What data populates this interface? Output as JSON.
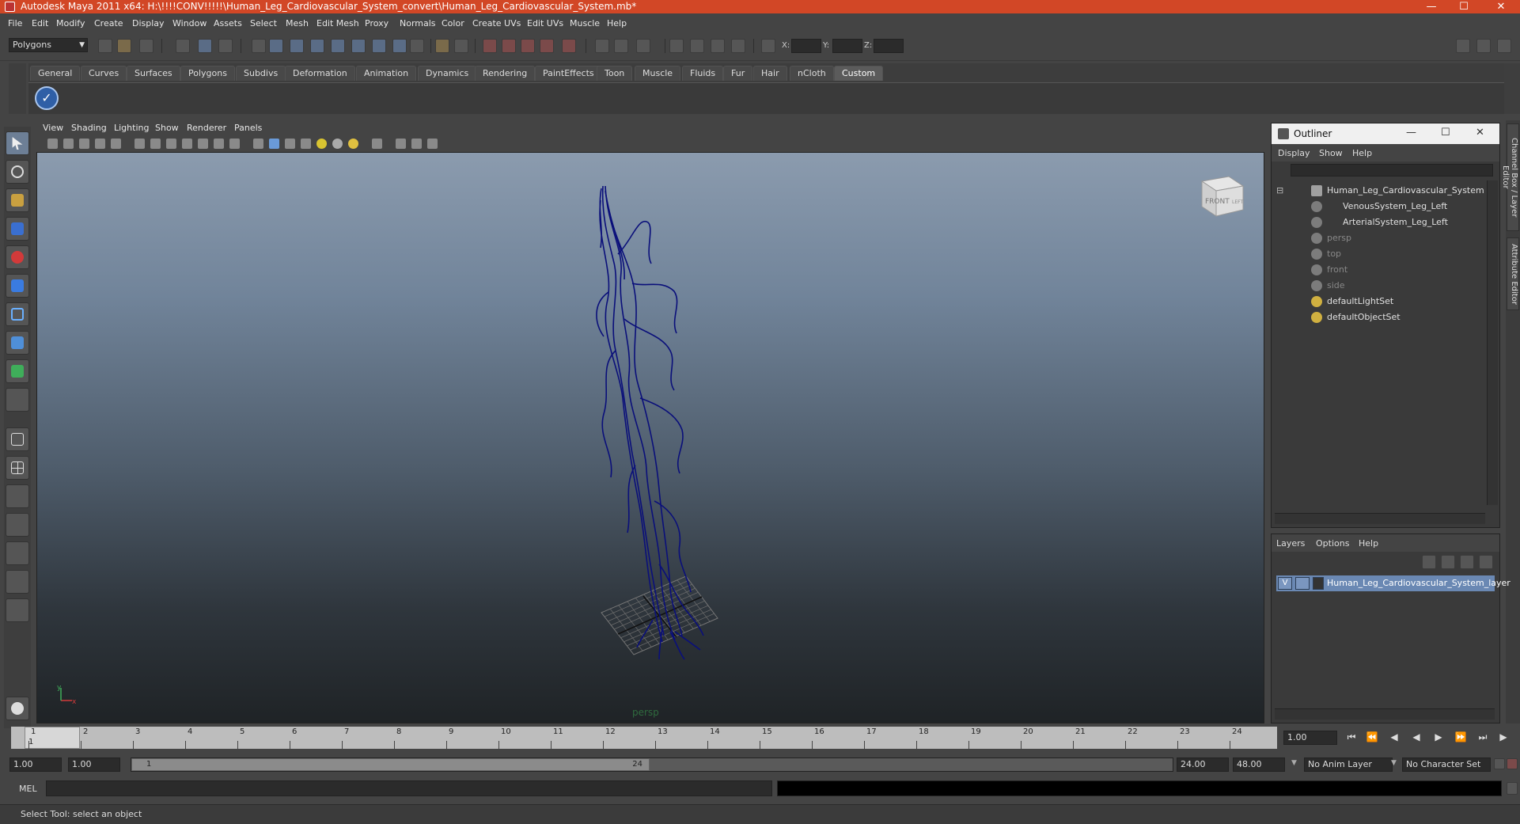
{
  "window": {
    "title": "Autodesk Maya 2011 x64: H:\\!!!!CONV!!!!!\\Human_Leg_Cardiovascular_System_convert\\Human_Leg_Cardiovascular_System.mb*"
  },
  "menu": [
    "File",
    "Edit",
    "Modify",
    "Create",
    "Display",
    "Window",
    "Assets",
    "Select",
    "Mesh",
    "Edit Mesh",
    "Proxy",
    "Normals",
    "Color",
    "Create UVs",
    "Edit UVs",
    "Muscle",
    "Help"
  ],
  "status_line": {
    "mode": "Polygons",
    "x_label": "X:",
    "y_label": "Y:",
    "z_label": "Z:"
  },
  "shelf": {
    "tabs": [
      "General",
      "Curves",
      "Surfaces",
      "Polygons",
      "Subdivs",
      "Deformation",
      "Animation",
      "Dynamics",
      "Rendering",
      "PaintEffects",
      "Toon",
      "Muscle",
      "Fluids",
      "Fur",
      "Hair",
      "nCloth",
      "Custom"
    ],
    "active_tab": "Custom"
  },
  "viewport": {
    "menu": [
      "View",
      "Shading",
      "Lighting",
      "Show",
      "Renderer",
      "Panels"
    ],
    "camera": "persp",
    "viewcube_label": "FRONT",
    "viewcube_side": "LEFT",
    "axis_x": "x",
    "axis_y": "y",
    "wire_color": "#0a0f7a"
  },
  "side_tabs": [
    "Channel Box / Layer Editor",
    "Attribute Editor"
  ],
  "outliner": {
    "title": "Outliner",
    "menu": [
      "Display",
      "Show",
      "Help"
    ],
    "items": [
      {
        "label": "Human_Leg_Cardiovascular_System",
        "dim": false
      },
      {
        "label": "VenousSystem_Leg_Left",
        "dim": false
      },
      {
        "label": "ArterialSystem_Leg_Left",
        "dim": false
      },
      {
        "label": "persp",
        "dim": true
      },
      {
        "label": "top",
        "dim": true
      },
      {
        "label": "front",
        "dim": true
      },
      {
        "label": "side",
        "dim": true
      },
      {
        "label": "defaultLightSet",
        "dim": false
      },
      {
        "label": "defaultObjectSet",
        "dim": false
      }
    ]
  },
  "layers": {
    "menu": [
      "Layers",
      "Options",
      "Help"
    ],
    "rows": [
      {
        "visible": "V",
        "name": "Human_Leg_Cardiovascular_System_layer"
      }
    ]
  },
  "timeline": {
    "ticks": [
      "1",
      "2",
      "3",
      "4",
      "5",
      "6",
      "7",
      "8",
      "9",
      "10",
      "11",
      "12",
      "13",
      "14",
      "15",
      "16",
      "17",
      "18",
      "19",
      "20",
      "21",
      "22",
      "23",
      "24"
    ],
    "current_frame_label": "1",
    "current_time": "1.00"
  },
  "range": {
    "start_time": "1.00",
    "playback_start": "1.00",
    "range_start": "1",
    "range_end": "24",
    "playback_end": "24.00",
    "end_time": "48.00",
    "anim_layer": "No Anim Layer",
    "character_set": "No Character Set"
  },
  "command_line": {
    "label": "MEL"
  },
  "help_line": "Select Tool: select an object"
}
